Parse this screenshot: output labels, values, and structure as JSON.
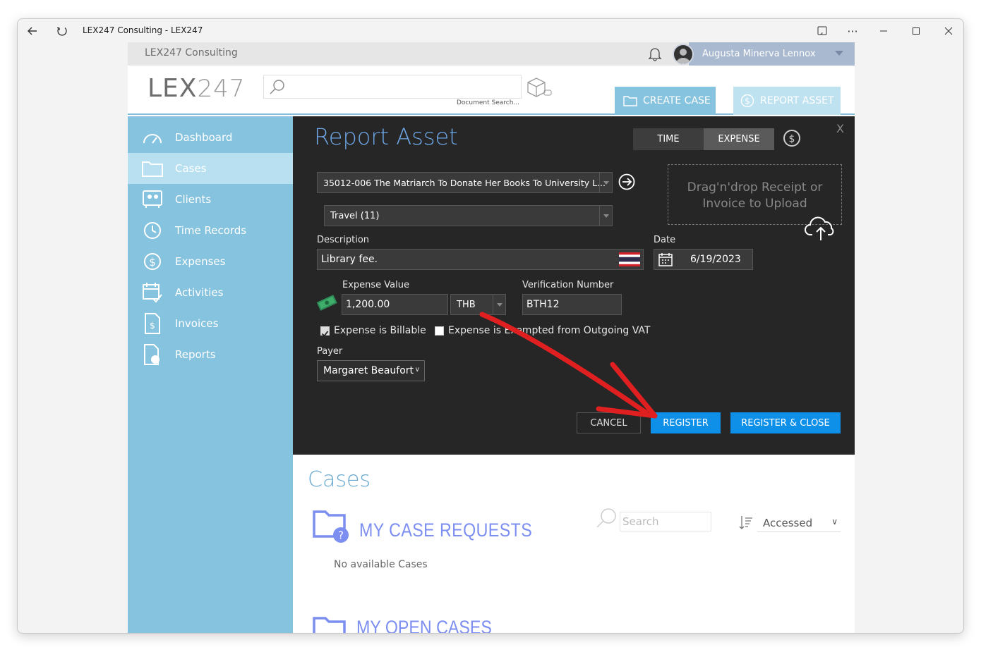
{
  "window": {
    "title": "LEX247 Consulting - LEX247"
  },
  "topbar": {
    "company": "LEX247 Consulting",
    "user_name": "Augusta Minerva Lennox"
  },
  "header": {
    "logo_main": "LEX",
    "logo_tail": "247",
    "doc_search_label": "Document Search...",
    "create_case_label": "CREATE CASE",
    "report_asset_label": "REPORT ASSET"
  },
  "sidebar": {
    "items": [
      {
        "label": "Dashboard"
      },
      {
        "label": "Cases"
      },
      {
        "label": "Clients"
      },
      {
        "label": "Time Records"
      },
      {
        "label": "Expenses"
      },
      {
        "label": "Activities"
      },
      {
        "label": "Invoices"
      },
      {
        "label": "Reports"
      }
    ],
    "active": "Cases"
  },
  "dialog": {
    "title": "Report Asset",
    "close_label": "X",
    "toggle_time": "TIME",
    "toggle_expense": "EXPENSE",
    "case_select": "35012-006 The Matriarch To Donate Her Books To University L...",
    "category_select": "Travel (11)",
    "dropzone_text": "Drag'n'drop Receipt or Invoice to Upload",
    "description_label": "Description",
    "description_value": "Library fee.",
    "date_label": "Date",
    "date_value": "6/19/2023",
    "expense_value_label": "Expense Value",
    "expense_value": "1,200.00",
    "currency": "THB",
    "verification_label": "Verification Number",
    "verification_value": "BTH12",
    "billable_label": "Expense is Billable",
    "billable_checked": true,
    "exempt_label": "Expense is Exempted from Outgoing VAT",
    "exempt_checked": false,
    "payer_label": "Payer",
    "payer_value": "Margaret Beaufort",
    "cancel_label": "CANCEL",
    "register_label": "REGISTER",
    "register_close_label": "REGISTER & CLOSE",
    "accent_color": "#0e8fe8",
    "title_color": "#6ea6e6"
  },
  "cases": {
    "title": "Cases",
    "my_case_requests": "MY CASE REQUESTS",
    "no_cases_text": "No available Cases",
    "search_placeholder": "Search",
    "sort_value": "Accessed",
    "my_open_cases": "MY OPEN CASES"
  },
  "colors": {
    "sidebar_bg": "#86c3df",
    "sidebar_active": "#b8e0f0",
    "dialog_bg": "#262626",
    "annotation_arrow": "#e02020"
  }
}
